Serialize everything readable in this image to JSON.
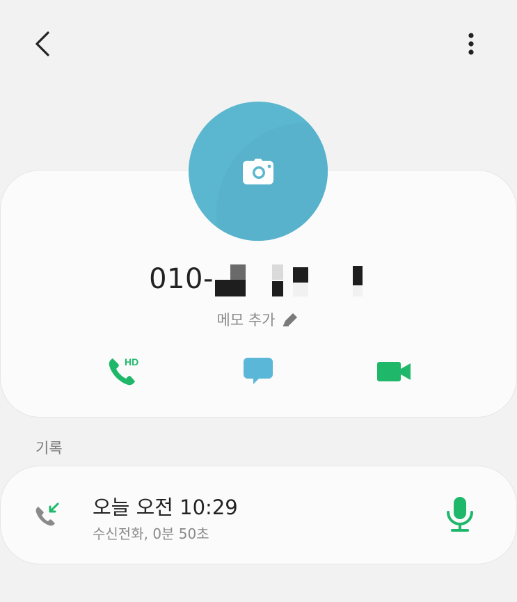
{
  "header": {
    "back_icon": "chevron-left-icon",
    "more_icon": "more-vertical-icon"
  },
  "contact": {
    "avatar_icon": "camera-icon",
    "avatar_color": "#5bb7cf",
    "phone_prefix": "010-",
    "memo_label": "메모 추가",
    "memo_icon": "pencil-icon"
  },
  "actions": [
    {
      "name": "hd-voice-call",
      "icon": "phone-hd-icon",
      "badge": "HD",
      "color": "#1fb86a"
    },
    {
      "name": "message",
      "icon": "message-bubble-icon",
      "color": "#5bb7d8"
    },
    {
      "name": "video-call",
      "icon": "video-camera-icon",
      "color": "#1fb86a"
    }
  ],
  "history": {
    "header": "기록",
    "entries": [
      {
        "time": "오늘 오전 10:29",
        "detail": "수신전화, 0분 50초",
        "type_icon": "incoming-call-icon",
        "record_icon": "microphone-icon"
      }
    ]
  },
  "colors": {
    "background": "#f2f2f2",
    "card": "#fbfbfb",
    "accent_green": "#1fb86a",
    "accent_blue": "#5bb7d8"
  }
}
